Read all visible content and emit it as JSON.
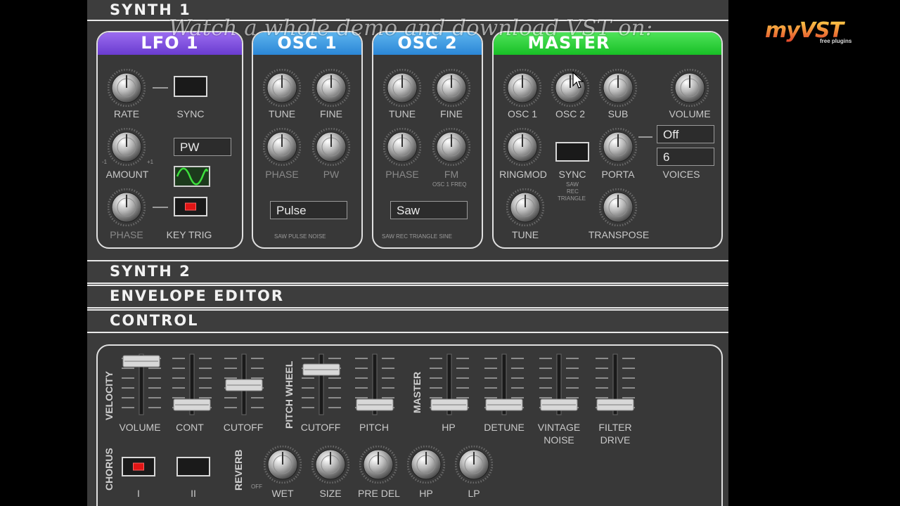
{
  "sections": {
    "synth1": "SYNTH 1",
    "synth2": "SYNTH 2",
    "envelope": "ENVELOPE EDITOR",
    "control": "CONTROL"
  },
  "overlay_text": "Watch a whole demo and download VST on:",
  "logo": {
    "main": "myVST",
    "sub": "free plugins"
  },
  "lfo1": {
    "title": "LFO 1",
    "rate": "RATE",
    "sync": "SYNC",
    "amount": "AMOUNT",
    "waveform": "PW",
    "phase": "PHASE",
    "key_trig": "KEY TRIG",
    "minus1": "-1",
    "plus1": "+1"
  },
  "osc1": {
    "title": "OSC 1",
    "tune": "TUNE",
    "fine": "FINE",
    "phase": "PHASE",
    "pw": "PW",
    "wave": "Pulse",
    "wave_options": "SAW PULSE NOISE"
  },
  "osc2": {
    "title": "OSC 2",
    "tune": "TUNE",
    "fine": "FINE",
    "phase": "PHASE",
    "fm": "FM",
    "fm_sub": "OSC 1 FREQ",
    "wave": "Saw",
    "wave_options": "SAW REC TRIANGLE SINE"
  },
  "master": {
    "title": "MASTER",
    "osc1": "OSC 1",
    "osc2": "OSC 2",
    "sub": "SUB",
    "volume": "VOLUME",
    "ringmod": "RINGMOD",
    "sync": "SYNC",
    "sync_sub1": "SAW",
    "sync_sub2": "REC",
    "sync_sub3": "TRIANGLE",
    "porta": "PORTA",
    "voices_label": "VOICES",
    "porta_value": "Off",
    "voices_value": "6",
    "tune": "TUNE",
    "transpose": "TRANSPOSE"
  },
  "control": {
    "velocity": "VELOCITY",
    "pitch_wheel": "PITCH WHEEL",
    "master": "MASTER",
    "chorus": "CHORUS",
    "reverb": "REVERB",
    "off": "OFF",
    "sliders": {
      "volume": "VOLUME",
      "cont": "CONT",
      "cutoff1": "CUTOFF",
      "cutoff2": "CUTOFF",
      "pitch": "PITCH",
      "hp": "HP",
      "detune": "DETUNE",
      "vintage": "VINTAGE",
      "noise": "NOISE",
      "filter": "FILTER",
      "drive": "DRIVE"
    },
    "chorus_i": "I",
    "chorus_ii": "II",
    "reverb_knobs": {
      "wet": "WET",
      "size": "SIZE",
      "pre_del": "PRE DEL",
      "hp": "HP",
      "lp": "LP"
    }
  }
}
